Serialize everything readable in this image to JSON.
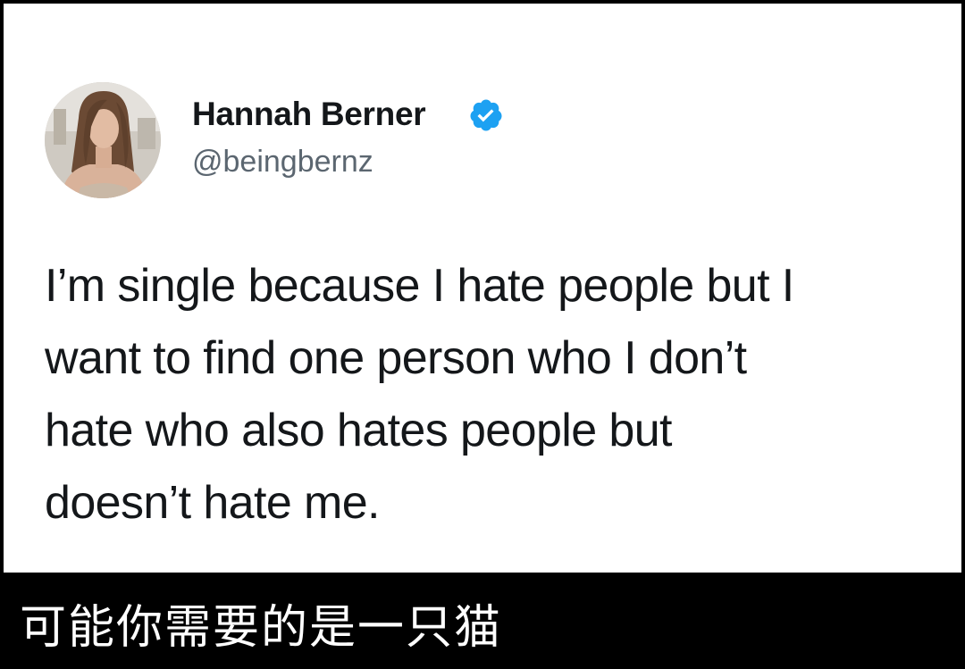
{
  "tweet": {
    "author": {
      "display_name": "Hannah Berner",
      "handle": "@beingbernz",
      "verified": true,
      "verified_icon": "verified-badge-icon",
      "avatar_icon": "profile-photo"
    },
    "text_lines": [
      "I’m single because I hate people but I",
      "want to find one person who I don’t",
      "hate who also hates people but",
      "doesn’t hate me."
    ]
  },
  "caption": "可能你需要的是一只猫",
  "colors": {
    "background": "#000000",
    "card": "#ffffff",
    "text": "#14171a",
    "handle": "#5b6670",
    "verified": "#1da1f2",
    "caption": "#ffffff"
  }
}
